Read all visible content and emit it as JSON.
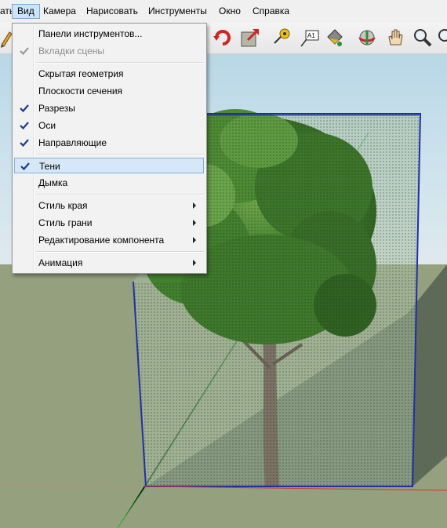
{
  "menubar": {
    "items": [
      {
        "label": "ать",
        "active": false
      },
      {
        "label": "Вид",
        "active": true
      },
      {
        "label": "Камера",
        "active": false
      },
      {
        "label": "Нарисовать",
        "active": false
      },
      {
        "label": "Инструменты",
        "active": false
      },
      {
        "label": "Окно",
        "active": false
      },
      {
        "label": "Справка",
        "active": false
      }
    ]
  },
  "toolbar": {
    "icons": [
      "pencil-icon",
      "rotate-icon",
      "scale-icon",
      "tape-measure-icon",
      "text-icon",
      "paint-bucket-icon",
      "orbit-icon",
      "pan-icon",
      "zoom-icon",
      "zoom-extents-icon"
    ]
  },
  "view_menu": {
    "items": [
      {
        "label": "Панели инструментов...",
        "checked": false,
        "disabled": false,
        "submenu": false
      },
      {
        "label": "Вкладки сцены",
        "checked": true,
        "disabled": true,
        "submenu": false
      },
      {
        "label": "Скрытая геометрия",
        "checked": false,
        "disabled": false,
        "submenu": false
      },
      {
        "label": "Плоскости сечения",
        "checked": false,
        "disabled": false,
        "submenu": false
      },
      {
        "label": "Разрезы",
        "checked": true,
        "disabled": false,
        "submenu": false
      },
      {
        "label": "Оси",
        "checked": true,
        "disabled": false,
        "submenu": false
      },
      {
        "label": "Направляющие",
        "checked": true,
        "disabled": false,
        "submenu": false
      },
      {
        "label": "Тени",
        "checked": true,
        "disabled": false,
        "submenu": false,
        "highlighted": true
      },
      {
        "label": "Дымка",
        "checked": false,
        "disabled": false,
        "submenu": false
      },
      {
        "label": "Стиль края",
        "checked": false,
        "disabled": false,
        "submenu": true
      },
      {
        "label": "Стиль грани",
        "checked": false,
        "disabled": false,
        "submenu": true
      },
      {
        "label": "Редактирование компонента",
        "checked": false,
        "disabled": false,
        "submenu": true
      },
      {
        "label": "Анимация",
        "checked": false,
        "disabled": false,
        "submenu": true
      }
    ]
  },
  "colors": {
    "menu_highlight": "#d6e8f8",
    "section_plane_edge": "#1f2fa8",
    "tree_green": "#3f7a2b",
    "ground": "#95a07e",
    "shadow": "#556051"
  }
}
